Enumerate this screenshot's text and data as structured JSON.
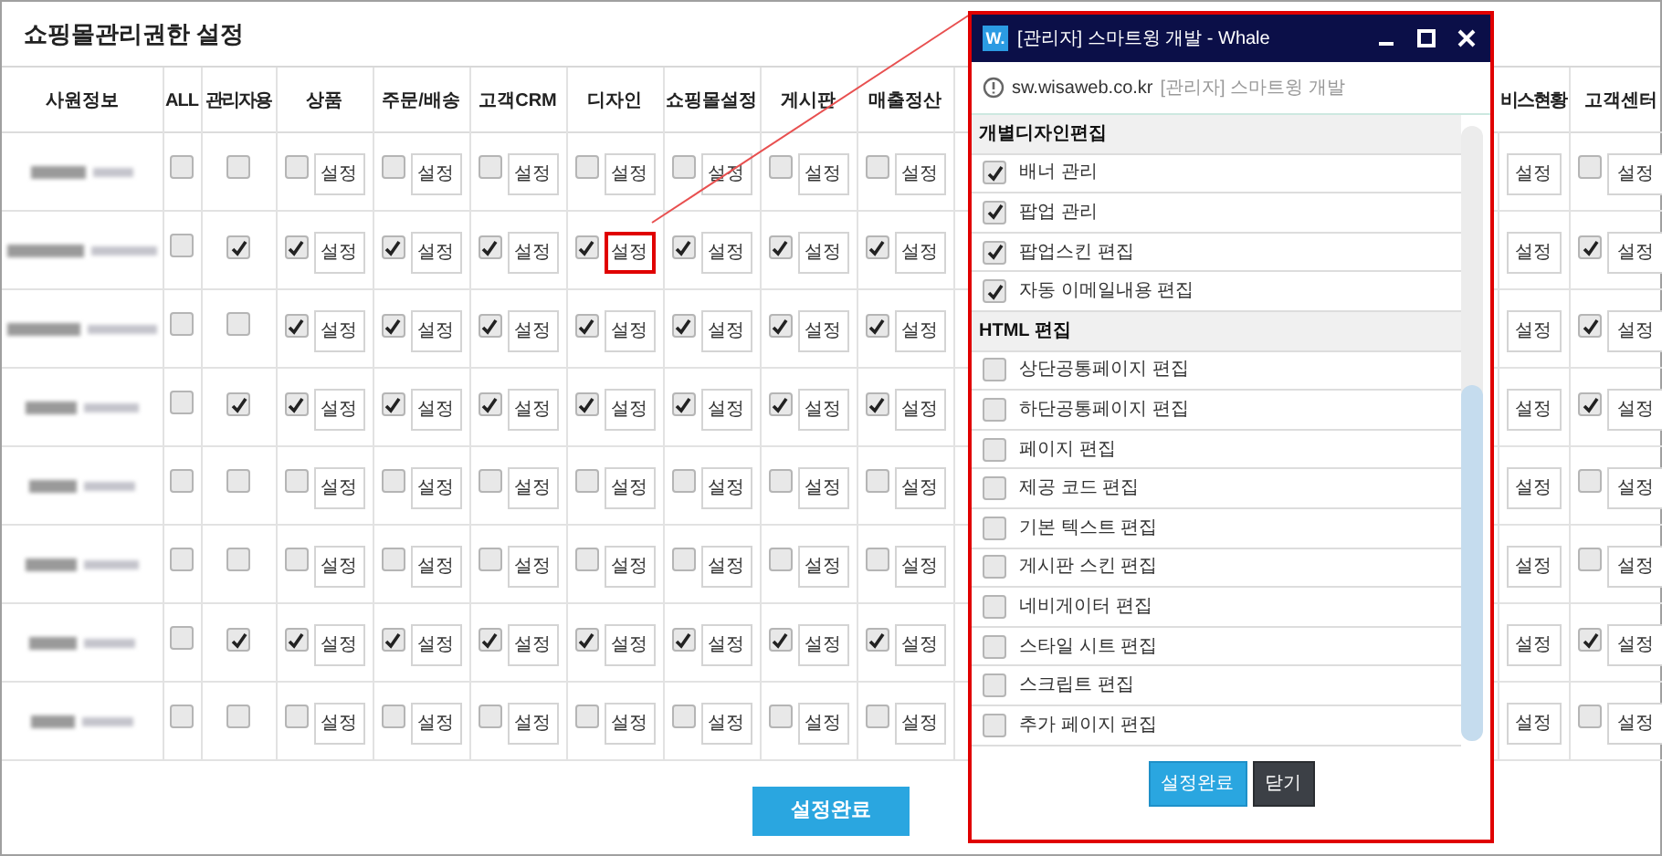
{
  "page_title": "쇼핑몰관리권한 설정",
  "table": {
    "columns": [
      "사원정보",
      "ALL",
      "관리자용",
      "상품",
      "주문/배송",
      "고객CRM",
      "디자인",
      "쇼핑몰설정",
      "게시판",
      "매출정산",
      "비스현황",
      "고객센터"
    ],
    "rows": [
      {
        "cells": [
          {
            "kind": "blurred"
          },
          {
            "kind": "checkbox",
            "checked": false
          },
          {
            "kind": "checkbox",
            "checked": false
          },
          {
            "kind": "check_button",
            "checked": false,
            "highlighted": false,
            "button": "설정"
          },
          {
            "kind": "check_button",
            "checked": false,
            "highlighted": false,
            "button": "설정"
          },
          {
            "kind": "check_button",
            "checked": false,
            "highlighted": false,
            "button": "설정"
          },
          {
            "kind": "check_button",
            "checked": false,
            "highlighted": false,
            "button": "설정"
          },
          {
            "kind": "check_button",
            "checked": false,
            "highlighted": false,
            "button": "설정"
          },
          {
            "kind": "check_button",
            "checked": false,
            "highlighted": false,
            "button": "설정"
          },
          {
            "kind": "check_button",
            "checked": false,
            "highlighted": false,
            "button": "설정"
          },
          {
            "kind": "button",
            "highlighted": false,
            "button": "설정"
          },
          {
            "kind": "check_button",
            "checked": false,
            "highlighted": false,
            "button": "설정"
          }
        ]
      },
      {
        "cells": [
          {
            "kind": "blurred"
          },
          {
            "kind": "checkbox",
            "checked": false
          },
          {
            "kind": "checkbox",
            "checked": true
          },
          {
            "kind": "check_button",
            "checked": true,
            "highlighted": false,
            "button": "설정"
          },
          {
            "kind": "check_button",
            "checked": true,
            "highlighted": false,
            "button": "설정"
          },
          {
            "kind": "check_button",
            "checked": true,
            "highlighted": false,
            "button": "설정"
          },
          {
            "kind": "check_button",
            "checked": true,
            "highlighted": true,
            "button": "설정"
          },
          {
            "kind": "check_button",
            "checked": true,
            "highlighted": false,
            "button": "설정"
          },
          {
            "kind": "check_button",
            "checked": true,
            "highlighted": false,
            "button": "설정"
          },
          {
            "kind": "check_button",
            "checked": true,
            "highlighted": false,
            "button": "설정"
          },
          {
            "kind": "button",
            "highlighted": false,
            "button": "설정"
          },
          {
            "kind": "check_button",
            "checked": true,
            "highlighted": false,
            "button": "설정"
          }
        ]
      },
      {
        "cells": [
          {
            "kind": "blurred"
          },
          {
            "kind": "checkbox",
            "checked": false
          },
          {
            "kind": "checkbox",
            "checked": false
          },
          {
            "kind": "check_button",
            "checked": true,
            "highlighted": false,
            "button": "설정"
          },
          {
            "kind": "check_button",
            "checked": true,
            "highlighted": false,
            "button": "설정"
          },
          {
            "kind": "check_button",
            "checked": true,
            "highlighted": false,
            "button": "설정"
          },
          {
            "kind": "check_button",
            "checked": true,
            "highlighted": false,
            "button": "설정"
          },
          {
            "kind": "check_button",
            "checked": true,
            "highlighted": false,
            "button": "설정"
          },
          {
            "kind": "check_button",
            "checked": true,
            "highlighted": false,
            "button": "설정"
          },
          {
            "kind": "check_button",
            "checked": true,
            "highlighted": false,
            "button": "설정"
          },
          {
            "kind": "button",
            "highlighted": false,
            "button": "설정"
          },
          {
            "kind": "check_button",
            "checked": true,
            "highlighted": false,
            "button": "설정"
          }
        ]
      },
      {
        "cells": [
          {
            "kind": "blurred"
          },
          {
            "kind": "checkbox",
            "checked": false
          },
          {
            "kind": "checkbox",
            "checked": true
          },
          {
            "kind": "check_button",
            "checked": true,
            "highlighted": false,
            "button": "설정"
          },
          {
            "kind": "check_button",
            "checked": true,
            "highlighted": false,
            "button": "설정"
          },
          {
            "kind": "check_button",
            "checked": true,
            "highlighted": false,
            "button": "설정"
          },
          {
            "kind": "check_button",
            "checked": true,
            "highlighted": false,
            "button": "설정"
          },
          {
            "kind": "check_button",
            "checked": true,
            "highlighted": false,
            "button": "설정"
          },
          {
            "kind": "check_button",
            "checked": true,
            "highlighted": false,
            "button": "설정"
          },
          {
            "kind": "check_button",
            "checked": true,
            "highlighted": false,
            "button": "설정"
          },
          {
            "kind": "button",
            "highlighted": false,
            "button": "설정"
          },
          {
            "kind": "check_button",
            "checked": true,
            "highlighted": false,
            "button": "설정"
          }
        ]
      },
      {
        "cells": [
          {
            "kind": "blurred"
          },
          {
            "kind": "checkbox",
            "checked": false
          },
          {
            "kind": "checkbox",
            "checked": false
          },
          {
            "kind": "check_button",
            "checked": false,
            "highlighted": false,
            "button": "설정"
          },
          {
            "kind": "check_button",
            "checked": false,
            "highlighted": false,
            "button": "설정"
          },
          {
            "kind": "check_button",
            "checked": false,
            "highlighted": false,
            "button": "설정"
          },
          {
            "kind": "check_button",
            "checked": false,
            "highlighted": false,
            "button": "설정"
          },
          {
            "kind": "check_button",
            "checked": false,
            "highlighted": false,
            "button": "설정"
          },
          {
            "kind": "check_button",
            "checked": false,
            "highlighted": false,
            "button": "설정"
          },
          {
            "kind": "check_button",
            "checked": false,
            "highlighted": false,
            "button": "설정"
          },
          {
            "kind": "button",
            "highlighted": false,
            "button": "설정"
          },
          {
            "kind": "check_button",
            "checked": false,
            "highlighted": false,
            "button": "설정"
          }
        ]
      },
      {
        "cells": [
          {
            "kind": "blurred"
          },
          {
            "kind": "checkbox",
            "checked": false
          },
          {
            "kind": "checkbox",
            "checked": false
          },
          {
            "kind": "check_button",
            "checked": false,
            "highlighted": false,
            "button": "설정"
          },
          {
            "kind": "check_button",
            "checked": false,
            "highlighted": false,
            "button": "설정"
          },
          {
            "kind": "check_button",
            "checked": false,
            "highlighted": false,
            "button": "설정"
          },
          {
            "kind": "check_button",
            "checked": false,
            "highlighted": false,
            "button": "설정"
          },
          {
            "kind": "check_button",
            "checked": false,
            "highlighted": false,
            "button": "설정"
          },
          {
            "kind": "check_button",
            "checked": false,
            "highlighted": false,
            "button": "설정"
          },
          {
            "kind": "check_button",
            "checked": false,
            "highlighted": false,
            "button": "설정"
          },
          {
            "kind": "button",
            "highlighted": false,
            "button": "설정"
          },
          {
            "kind": "check_button",
            "checked": false,
            "highlighted": false,
            "button": "설정"
          }
        ]
      },
      {
        "cells": [
          {
            "kind": "blurred"
          },
          {
            "kind": "checkbox",
            "checked": false
          },
          {
            "kind": "checkbox",
            "checked": true
          },
          {
            "kind": "check_button",
            "checked": true,
            "highlighted": false,
            "button": "설정"
          },
          {
            "kind": "check_button",
            "checked": true,
            "highlighted": false,
            "button": "설정"
          },
          {
            "kind": "check_button",
            "checked": true,
            "highlighted": false,
            "button": "설정"
          },
          {
            "kind": "check_button",
            "checked": true,
            "highlighted": false,
            "button": "설정"
          },
          {
            "kind": "check_button",
            "checked": true,
            "highlighted": false,
            "button": "설정"
          },
          {
            "kind": "check_button",
            "checked": true,
            "highlighted": false,
            "button": "설정"
          },
          {
            "kind": "check_button",
            "checked": true,
            "highlighted": false,
            "button": "설정"
          },
          {
            "kind": "button",
            "highlighted": false,
            "button": "설정"
          },
          {
            "kind": "check_button",
            "checked": true,
            "highlighted": false,
            "button": "설정"
          }
        ]
      },
      {
        "cells": [
          {
            "kind": "blurred"
          },
          {
            "kind": "checkbox",
            "checked": false
          },
          {
            "kind": "checkbox",
            "checked": false
          },
          {
            "kind": "check_button",
            "checked": false,
            "highlighted": false,
            "button": "설정"
          },
          {
            "kind": "check_button",
            "checked": false,
            "highlighted": false,
            "button": "설정"
          },
          {
            "kind": "check_button",
            "checked": false,
            "highlighted": false,
            "button": "설정"
          },
          {
            "kind": "check_button",
            "checked": false,
            "highlighted": false,
            "button": "설정"
          },
          {
            "kind": "check_button",
            "checked": false,
            "highlighted": false,
            "button": "설정"
          },
          {
            "kind": "check_button",
            "checked": false,
            "highlighted": false,
            "button": "설정"
          },
          {
            "kind": "check_button",
            "checked": false,
            "highlighted": false,
            "button": "설정"
          },
          {
            "kind": "button",
            "highlighted": false,
            "button": "설정"
          },
          {
            "kind": "check_button",
            "checked": false,
            "highlighted": false,
            "button": "설정"
          }
        ]
      }
    ]
  },
  "save_button": "설정완료",
  "popup": {
    "logo": "W.",
    "title": "[관리자] 스마트윙 개발 - Whale",
    "address": {
      "domain": "sw.wisaweb.co.kr",
      "page_title": "[관리자] 스마트윙 개발"
    },
    "sections": [
      {
        "title": "개별디자인편집",
        "items": [
          {
            "label": "배너 관리",
            "checked": true
          },
          {
            "label": "팝업 관리",
            "checked": true
          },
          {
            "label": "팝업스킨 편집",
            "checked": true
          },
          {
            "label": "자동 이메일내용 편집",
            "checked": true
          }
        ]
      },
      {
        "title": "HTML 편집",
        "items": [
          {
            "label": "상단공통페이지 편집",
            "checked": false
          },
          {
            "label": "하단공통페이지 편집",
            "checked": false
          },
          {
            "label": "페이지 편집",
            "checked": false
          },
          {
            "label": "제공 코드 편집",
            "checked": false
          },
          {
            "label": "기본 텍스트 편집",
            "checked": false
          },
          {
            "label": "게시판 스킨 편집",
            "checked": false
          },
          {
            "label": "네비게이터 편집",
            "checked": false
          },
          {
            "label": "스타일 시트 편집",
            "checked": false
          },
          {
            "label": "스크립트 편집",
            "checked": false
          },
          {
            "label": "추가 페이지 편집",
            "checked": false
          }
        ]
      }
    ],
    "buttons": [
      {
        "label": "설정완료",
        "kind": "primary"
      },
      {
        "label": "닫기",
        "kind": "secondary"
      }
    ]
  }
}
